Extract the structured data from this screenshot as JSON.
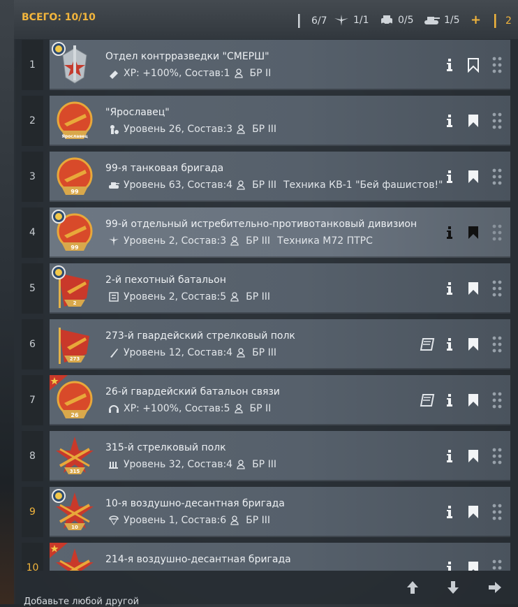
{
  "header": {
    "total_label": "ВСЕГО: 10/10",
    "stats": [
      {
        "icon": "infantry-icon",
        "value": "6/7"
      },
      {
        "icon": "aircraft-icon",
        "value": "1/1"
      },
      {
        "icon": "vehicle-icon",
        "value": "0/5"
      },
      {
        "icon": "tank-icon",
        "value": "1/5"
      }
    ],
    "add_label": "+",
    "gold_value": "2"
  },
  "rows": [
    {
      "num": "1",
      "title": "Отдел контрразведки \"СМЕРШ\"",
      "sub": "XP: +100%, Состав:1",
      "br": "БР II",
      "extra": "",
      "badge": "seal",
      "bookmark": "outline",
      "book": false
    },
    {
      "num": "2",
      "title": "\"Ярославец\"",
      "sub": "Уровень 26, Состав:3",
      "br": "БР III",
      "extra": "",
      "badge": "",
      "bookmark": "filled",
      "book": false
    },
    {
      "num": "3",
      "title": "99-я танковая бригада",
      "sub": "Уровень 63, Состав:4",
      "br": "БР III",
      "extra": "Техника КВ-1 \"Бей фашистов!\"",
      "badge": "",
      "bookmark": "filled",
      "book": false
    },
    {
      "num": "4",
      "title": "99-й отдельный истребительно-противотанковый дивизион",
      "sub": "Уровень 2, Состав:3",
      "br": "БР III",
      "extra": "Техника M72 ПТРС",
      "badge": "seal",
      "bookmark": "filled-dark",
      "book": false
    },
    {
      "num": "5",
      "title": "2-й пехотный батальон",
      "sub": "Уровень 2, Состав:5",
      "br": "БР III",
      "extra": "",
      "badge": "seal",
      "bookmark": "filled",
      "book": false
    },
    {
      "num": "6",
      "title": "273-й гвардейский стрелковый полк",
      "sub": "Уровень 12, Состав:4",
      "br": "БР III",
      "extra": "",
      "badge": "",
      "bookmark": "filled",
      "book": true
    },
    {
      "num": "7",
      "title": "26-й гвардейский батальон связи",
      "sub": "XP: +100%, Состав:5",
      "br": "БР II",
      "extra": "",
      "badge": "star",
      "bookmark": "filled",
      "book": true
    },
    {
      "num": "8",
      "title": "315-й стрелковый полк",
      "sub": "Уровень 32, Состав:4",
      "br": "БР III",
      "extra": "",
      "badge": "",
      "bookmark": "filled",
      "book": false
    },
    {
      "num": "9",
      "title": "10-я воздушно-десантная бригада",
      "sub": "Уровень 1, Состав:6",
      "br": "БР III",
      "extra": "",
      "badge": "seal",
      "bookmark": "filled",
      "book": false
    },
    {
      "num": "10",
      "title": "214-я воздушно-десантная бригада",
      "sub": "",
      "br": "",
      "extra": "",
      "badge": "star",
      "bookmark": "filled",
      "book": false
    }
  ],
  "emblem_numbers": [
    "",
    "Ярославец",
    "99",
    "99",
    "2",
    "273",
    "26",
    "315",
    "10",
    ""
  ],
  "bottom_text": "Добавьте любой другой"
}
